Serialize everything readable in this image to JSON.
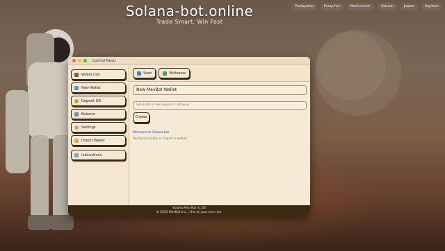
{
  "header": {
    "title": "Solana-bot.online",
    "tagline": "Trade Smart, Win Fast",
    "nav": [
      "Pumpportal",
      "Pump.Fun",
      "DexScreener",
      "Solscan",
      "Jupiter",
      "Raydium"
    ]
  },
  "window": {
    "title": "Control Panel"
  },
  "sidebar": {
    "items": [
      {
        "label": "Wallet Info",
        "icon": "wallet-icon"
      },
      {
        "label": "New Wallet",
        "icon": "new-wallet-icon"
      },
      {
        "label": "Deposit QR",
        "icon": "qr-icon"
      },
      {
        "label": "Balance",
        "icon": "balance-icon"
      },
      {
        "label": "Settings",
        "icon": "gear-icon"
      },
      {
        "label": "Import Wallet",
        "icon": "import-icon"
      },
      {
        "label": "Instructions",
        "icon": "book-icon"
      }
    ]
  },
  "toolbar": {
    "start_label": "Start",
    "withdraw_label": "Withdraw"
  },
  "main": {
    "wallet_title": "New MevBot Wallet",
    "keypair_placeholder": "Generate a new keypair in browser",
    "create_label": "Create",
    "log": [
      "Welcome to Solana-bot",
      "Ready to create or import a wallet."
    ]
  },
  "footer": {
    "version": "Solana Mev Bot v1.03",
    "copyright": "© 2025 MevBot Inc. | Use at your own risk."
  },
  "colors": {
    "window_bg": "#f6ead6",
    "footer_bg": "#3b2a12",
    "log_info": "#4a2fd8",
    "log_ready": "#2d9a2d"
  }
}
